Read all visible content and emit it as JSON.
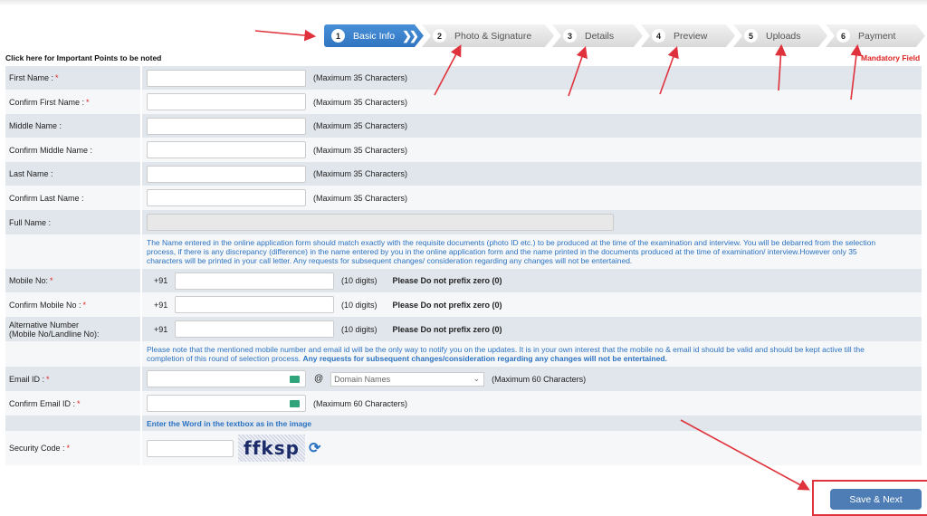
{
  "steps": [
    {
      "num": "1",
      "label": "Basic Info",
      "active": true
    },
    {
      "num": "2",
      "label": "Photo & Signature"
    },
    {
      "num": "3",
      "label": "Details"
    },
    {
      "num": "4",
      "label": "Preview"
    },
    {
      "num": "5",
      "label": "Uploads"
    },
    {
      "num": "6",
      "label": "Payment"
    }
  ],
  "important_link": "Click here for Important Points to be noted",
  "mandatory": "Mandatory Field",
  "fields": {
    "first_name": {
      "label": "First Name :",
      "hint": "(Maximum 35 Characters)",
      "value": ""
    },
    "confirm_first_name": {
      "label": "Confirm First Name :",
      "hint": "(Maximum 35 Characters)",
      "value": ""
    },
    "middle_name": {
      "label": "Middle Name :",
      "hint": "(Maximum 35 Characters)",
      "value": ""
    },
    "confirm_middle_name": {
      "label": "Confirm Middle Name :",
      "hint": "(Maximum 35 Characters)",
      "value": ""
    },
    "last_name": {
      "label": "Last Name :",
      "hint": "(Maximum 35 Characters)",
      "value": ""
    },
    "confirm_last_name": {
      "label": "Confirm Last Name :",
      "hint": "(Maximum 35 Characters)",
      "value": ""
    },
    "full_name": {
      "label": "Full Name :",
      "value": ""
    },
    "name_note": "The Name entered in the online application form should match exactly with the requisite documents (photo ID etc.) to be produced at the time of the examination and interview. You will be debarred from the selection process, if there is any discrepancy (difference) in the name entered by you in the online application form and the name printed in the documents produced at the time of examination/ interview.However only 35 characters will be printed in your call letter. Any requests for subsequent changes/ consideration regarding any changes will not be entertained.",
    "mobile": {
      "label": "Mobile No:",
      "prefix": "+91",
      "hint": "(10 digits)",
      "warning": "Please Do not prefix zero (0)"
    },
    "confirm_mobile": {
      "label": "Confirm Mobile No :",
      "prefix": "+91",
      "hint": "(10 digits)",
      "warning": "Please Do not prefix zero (0)"
    },
    "alt_number": {
      "label": "Alternative Number",
      "label2": "(Mobile No/Landline No):",
      "prefix": "+91",
      "hint": "(10 digits)",
      "warning": "Please Do not prefix zero (0)"
    },
    "contact_note": "Please note that the mentioned mobile number and email id will be the only way to notify you on the updates. It is in your own interest that the mobile no & email id should be valid and should be kept active till the completion of this round of selection process. ",
    "contact_note_bold": "Any requests for subsequent changes/consideration regarding any changes will not be entertained.",
    "email": {
      "label": "Email ID :",
      "at": "@",
      "domain_selected": "Domain Names",
      "hint": "(Maximum 60 Characters)"
    },
    "confirm_email": {
      "label": "Confirm Email ID :",
      "hint": "(Maximum 60 Characters)"
    },
    "captcha_heading": "Enter the Word in the textbox as in the image",
    "security": {
      "label": "Security Code :",
      "captcha_text": "ffksp"
    }
  },
  "required_mark": "*",
  "save_button": "Save & Next",
  "colors": {
    "accent": "#2f74c0",
    "row_grey": "#e1e6ec",
    "row_light": "#f6f7f8",
    "required": "#dd2222",
    "annotation": "#e0323c",
    "button": "#4d7db4"
  }
}
